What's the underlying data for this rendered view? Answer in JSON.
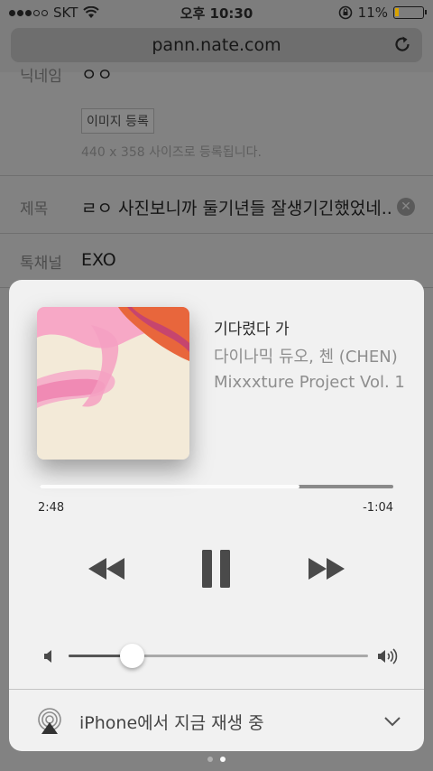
{
  "status_bar": {
    "carrier": "SKT",
    "time": "오후 10:30",
    "battery": "11%"
  },
  "browser": {
    "url": "pann.nate.com"
  },
  "form": {
    "nickname_label": "닉네임",
    "nickname_value": "ㅇㅇ",
    "image_button": "이미지 등록",
    "image_hint": "440 x 358 사이즈로 등록됩니다.",
    "title_label": "제목",
    "title_value": "ㄹㅇ 사진보니까 둘기년들 잘생기긴했었네...",
    "channel_label": "톡채널",
    "channel_value": "EXO"
  },
  "now_playing": {
    "title": "기다렸다 가",
    "artist": "다이나믹 듀오, 첸 (CHEN)",
    "album": "Mixxxture Project Vol. 1",
    "elapsed": "2:48",
    "remaining": "-1:04",
    "progress": 0.735,
    "volume": 0.21,
    "output_label": "iPhone에서 지금 재생 중"
  },
  "colors": {
    "accent_pink": "#f28ab5",
    "accent_orange": "#e8663c",
    "art_bg": "#f3ead8"
  },
  "icons": {
    "reload": "reload-icon",
    "rewind": "rewind-icon",
    "pause": "pause-icon",
    "forward": "fast-forward-icon",
    "volume_low": "speaker-low-icon",
    "volume_high": "speaker-high-icon",
    "airplay": "airplay-icon",
    "chevron": "chevron-down-icon"
  }
}
